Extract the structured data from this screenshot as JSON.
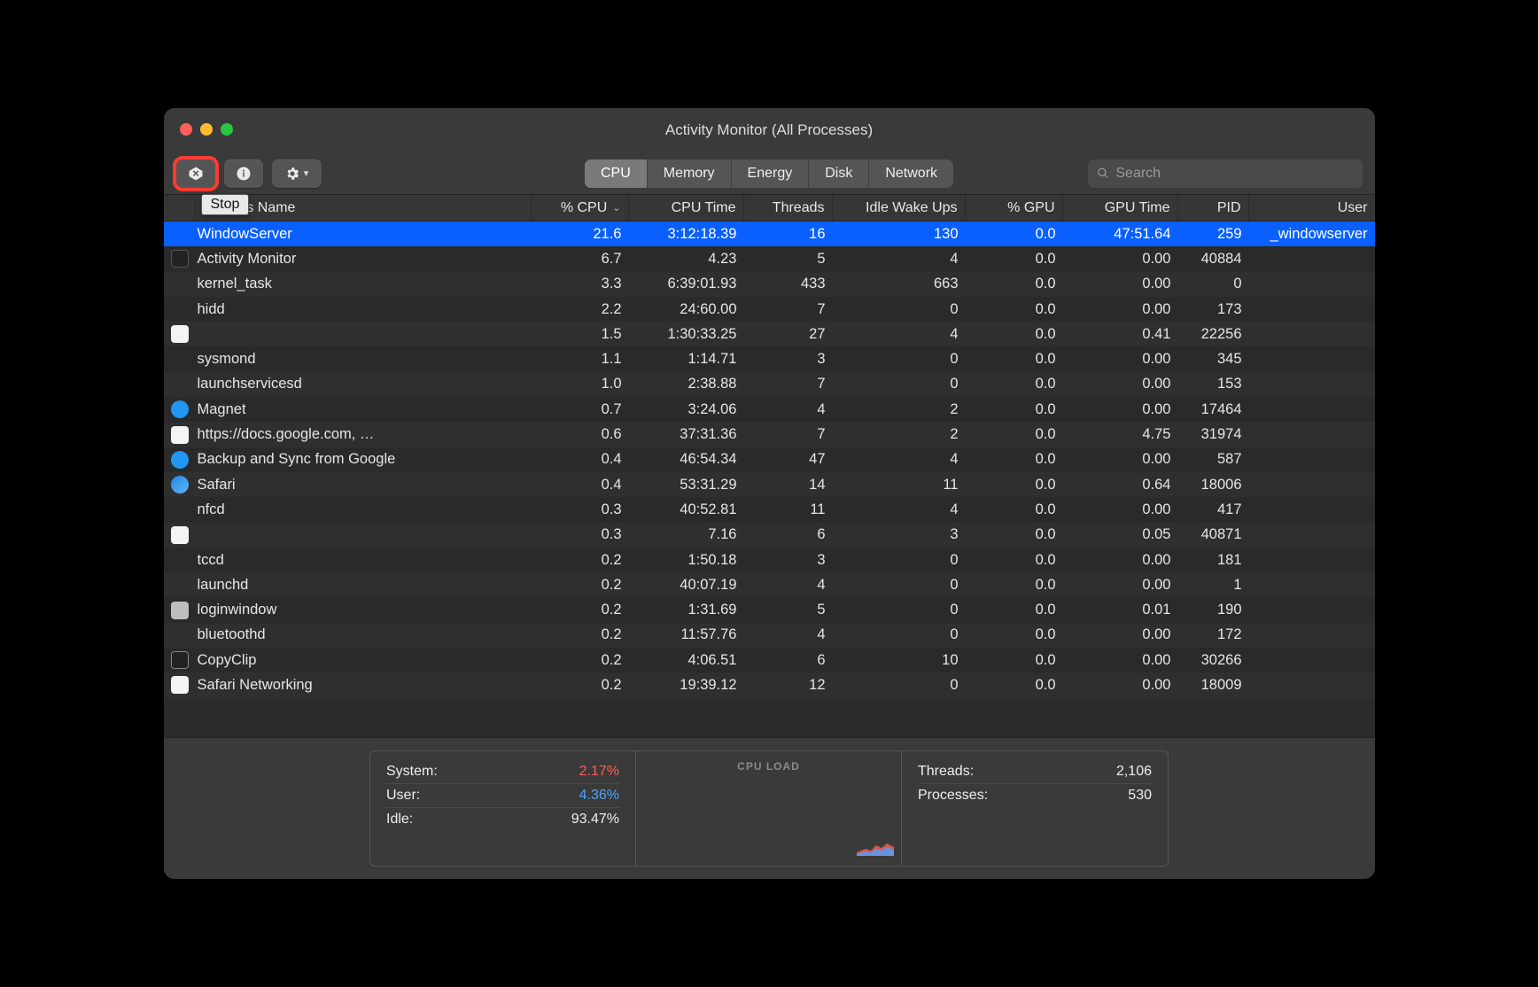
{
  "window": {
    "title": "Activity Monitor (All Processes)"
  },
  "tooltip": "Stop",
  "tabs": [
    "CPU",
    "Memory",
    "Energy",
    "Disk",
    "Network"
  ],
  "search": {
    "placeholder": "Search"
  },
  "columns": {
    "name": "Process Name",
    "cpu": "% CPU",
    "time": "CPU Time",
    "threads": "Threads",
    "idle": "Idle Wake Ups",
    "gpu": "% GPU",
    "gputime": "GPU Time",
    "pid": "PID",
    "user": "User"
  },
  "rows": [
    {
      "name": "WindowServer",
      "cpu": "21.6",
      "time": "3:12:18.39",
      "threads": "16",
      "idle": "130",
      "gpu": "0.0",
      "gputime": "47:51.64",
      "pid": "259",
      "user": "_windowserver",
      "selected": true,
      "icon": ""
    },
    {
      "name": "Activity Monitor",
      "cpu": "6.7",
      "time": "4.23",
      "threads": "5",
      "idle": "4",
      "gpu": "0.0",
      "gputime": "0.00",
      "pid": "40884",
      "user": "",
      "icon": "chart"
    },
    {
      "name": "kernel_task",
      "cpu": "3.3",
      "time": "6:39:01.93",
      "threads": "433",
      "idle": "663",
      "gpu": "0.0",
      "gputime": "0.00",
      "pid": "0",
      "user": ""
    },
    {
      "name": "hidd",
      "cpu": "2.2",
      "time": "24:60.00",
      "threads": "7",
      "idle": "0",
      "gpu": "0.0",
      "gputime": "0.00",
      "pid": "173",
      "user": ""
    },
    {
      "name": "",
      "cpu": "1.5",
      "time": "1:30:33.25",
      "threads": "27",
      "idle": "4",
      "gpu": "0.0",
      "gputime": "0.41",
      "pid": "22256",
      "user": "",
      "icon": "doc"
    },
    {
      "name": "sysmond",
      "cpu": "1.1",
      "time": "1:14.71",
      "threads": "3",
      "idle": "0",
      "gpu": "0.0",
      "gputime": "0.00",
      "pid": "345",
      "user": ""
    },
    {
      "name": "launchservicesd",
      "cpu": "1.0",
      "time": "2:38.88",
      "threads": "7",
      "idle": "0",
      "gpu": "0.0",
      "gputime": "0.00",
      "pid": "153",
      "user": ""
    },
    {
      "name": "Magnet",
      "cpu": "0.7",
      "time": "3:24.06",
      "threads": "4",
      "idle": "2",
      "gpu": "0.0",
      "gputime": "0.00",
      "pid": "17464",
      "user": "",
      "icon": "magnet"
    },
    {
      "name": "https://docs.google.com, …",
      "cpu": "0.6",
      "time": "37:31.36",
      "threads": "7",
      "idle": "2",
      "gpu": "0.0",
      "gputime": "4.75",
      "pid": "31974",
      "user": "",
      "icon": "doc"
    },
    {
      "name": "Backup and Sync from Google",
      "cpu": "0.4",
      "time": "46:54.34",
      "threads": "47",
      "idle": "4",
      "gpu": "0.0",
      "gputime": "0.00",
      "pid": "587",
      "user": "",
      "icon": "gdrive"
    },
    {
      "name": "Safari",
      "cpu": "0.4",
      "time": "53:31.29",
      "threads": "14",
      "idle": "11",
      "gpu": "0.0",
      "gputime": "0.64",
      "pid": "18006",
      "user": "",
      "icon": "safari"
    },
    {
      "name": "nfcd",
      "cpu": "0.3",
      "time": "40:52.81",
      "threads": "11",
      "idle": "4",
      "gpu": "0.0",
      "gputime": "0.00",
      "pid": "417",
      "user": ""
    },
    {
      "name": "",
      "cpu": "0.3",
      "time": "7.16",
      "threads": "6",
      "idle": "3",
      "gpu": "0.0",
      "gputime": "0.05",
      "pid": "40871",
      "user": "",
      "icon": "doc"
    },
    {
      "name": "tccd",
      "cpu": "0.2",
      "time": "1:50.18",
      "threads": "3",
      "idle": "0",
      "gpu": "0.0",
      "gputime": "0.00",
      "pid": "181",
      "user": ""
    },
    {
      "name": "launchd",
      "cpu": "0.2",
      "time": "40:07.19",
      "threads": "4",
      "idle": "0",
      "gpu": "0.0",
      "gputime": "0.00",
      "pid": "1",
      "user": ""
    },
    {
      "name": "loginwindow",
      "cpu": "0.2",
      "time": "1:31.69",
      "threads": "5",
      "idle": "0",
      "gpu": "0.0",
      "gputime": "0.01",
      "pid": "190",
      "user": "",
      "icon": "login"
    },
    {
      "name": "bluetoothd",
      "cpu": "0.2",
      "time": "11:57.76",
      "threads": "4",
      "idle": "0",
      "gpu": "0.0",
      "gputime": "0.00",
      "pid": "172",
      "user": ""
    },
    {
      "name": "CopyClip",
      "cpu": "0.2",
      "time": "4:06.51",
      "threads": "6",
      "idle": "10",
      "gpu": "0.0",
      "gputime": "0.00",
      "pid": "30266",
      "user": "",
      "icon": "clip"
    },
    {
      "name": "Safari Networking",
      "cpu": "0.2",
      "time": "19:39.12",
      "threads": "12",
      "idle": "0",
      "gpu": "0.0",
      "gputime": "0.00",
      "pid": "18009",
      "user": "",
      "icon": "doc"
    }
  ],
  "footer": {
    "left": [
      {
        "label": "System:",
        "value": "2.17%",
        "cls": "v-red"
      },
      {
        "label": "User:",
        "value": "4.36%",
        "cls": "v-blue"
      },
      {
        "label": "Idle:",
        "value": "93.47%",
        "cls": ""
      }
    ],
    "center_label": "CPU LOAD",
    "right": [
      {
        "label": "Threads:",
        "value": "2,106"
      },
      {
        "label": "Processes:",
        "value": "530"
      }
    ]
  }
}
